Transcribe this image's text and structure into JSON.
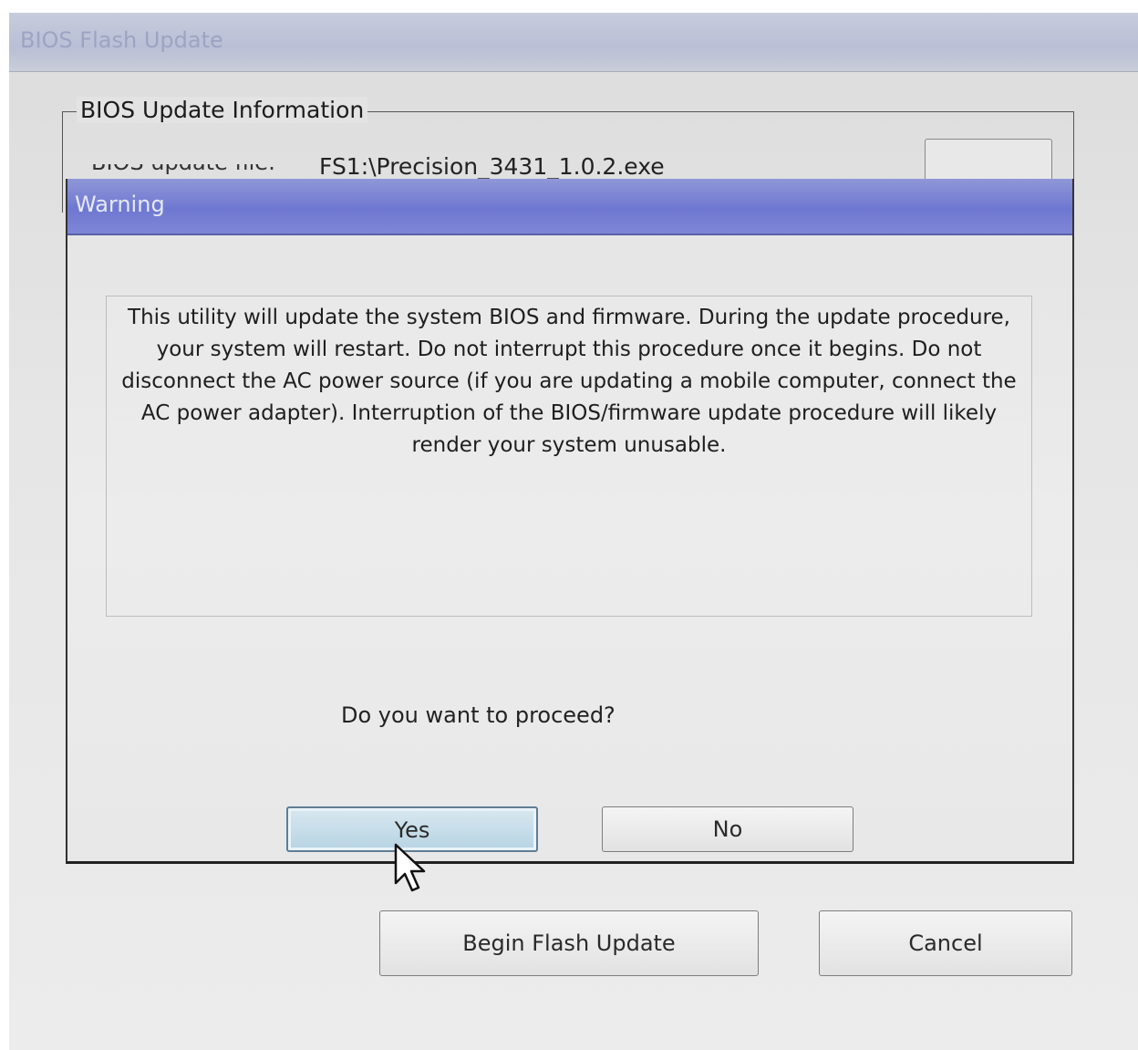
{
  "main_window": {
    "title": "BIOS Flash Update",
    "group_title": "BIOS Update Information",
    "file_label": "BIOS update file:",
    "file_value": "FS1:\\Precision_3431_1.0.2.exe",
    "begin_button": "Begin Flash Update",
    "cancel_button": "Cancel"
  },
  "warning_dialog": {
    "title": "Warning",
    "message": "This utility will update the system BIOS and firmware.  During the update procedure, your system will restart. Do not interrupt this procedure once it begins.  Do not disconnect the AC power source (if you are updating a mobile computer, connect the AC power adapter).  Interruption of the BIOS/firmware update procedure will likely render your system unusable.",
    "question": "Do you want to proceed?",
    "yes_button": "Yes",
    "no_button": "No"
  },
  "colors": {
    "warning_titlebar": "#7078d1",
    "yes_button_highlight": "#b7d3e3"
  },
  "icons": {
    "cursor": "mouse-pointer-icon"
  }
}
